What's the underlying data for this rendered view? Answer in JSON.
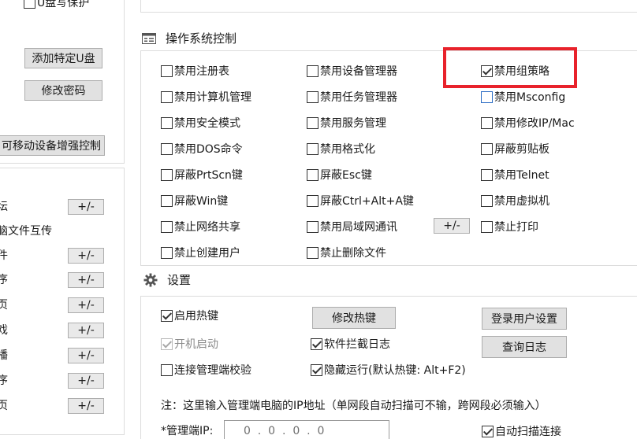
{
  "left_panel": {
    "usb_protect_label": "U盘写保护",
    "add_usb_button": "添加特定U盘",
    "change_password_button": "修改密码",
    "removable_enhanced_button": "可移动设备增强控制",
    "rows": [
      {
        "label": "坛",
        "has_button": true
      },
      {
        "label": "脑文件互传",
        "has_button": false
      },
      {
        "label": "件",
        "has_button": true
      },
      {
        "label": "序",
        "has_button": true
      },
      {
        "label": "页",
        "has_button": true
      },
      {
        "label": "戏",
        "has_button": true
      },
      {
        "label": "播",
        "has_button": true
      },
      {
        "label": "序",
        "has_button": true
      },
      {
        "label": "页",
        "has_button": true
      }
    ],
    "pm_label": "+/-"
  },
  "os_control": {
    "title": "操作系统控制",
    "col1": [
      {
        "label": "禁用注册表",
        "checked": false
      },
      {
        "label": "禁用计算机管理",
        "checked": false
      },
      {
        "label": "禁用安全模式",
        "checked": false
      },
      {
        "label": "禁用DOS命令",
        "checked": false
      },
      {
        "label": "屏蔽PrtScn键",
        "checked": false
      },
      {
        "label": "屏蔽Win键",
        "checked": false
      },
      {
        "label": "禁止网络共享",
        "checked": false
      },
      {
        "label": "禁止创建用户",
        "checked": false
      }
    ],
    "col2": [
      {
        "label": "禁用设备管理器",
        "checked": false
      },
      {
        "label": "禁用任务管理器",
        "checked": false
      },
      {
        "label": "禁用服务管理",
        "checked": false
      },
      {
        "label": "禁用格式化",
        "checked": false
      },
      {
        "label": "屏蔽Esc键",
        "checked": false
      },
      {
        "label": "屏蔽Ctrl+Alt+A键",
        "checked": false
      },
      {
        "label": "禁用局域网通讯",
        "checked": false
      },
      {
        "label": "禁止删除文件",
        "checked": false
      }
    ],
    "col3": [
      {
        "label": "禁用组策略",
        "checked": true
      },
      {
        "label": "禁用Msconfig",
        "checked": false
      },
      {
        "label": "禁用修改IP/Mac",
        "checked": false
      },
      {
        "label": "屏蔽剪贴板",
        "checked": false
      },
      {
        "label": "禁用Telnet",
        "checked": false
      },
      {
        "label": "禁用虚拟机",
        "checked": false
      },
      {
        "label": "禁止打印",
        "checked": false
      }
    ],
    "lan_pm_label": "+/-",
    "highlight_color": "#e8222b"
  },
  "settings": {
    "title": "设置",
    "enable_hotkey": {
      "label": "启用热键",
      "checked": true
    },
    "auto_start": {
      "label": "开机启动",
      "checked": true
    },
    "connect_verify": {
      "label": "连接管理端校验",
      "checked": false
    },
    "modify_hotkey_button": "修改热键",
    "block_log": {
      "label": "软件拦截日志",
      "checked": true
    },
    "hidden_run": {
      "label": "隐藏运行(默认热键: Alt+F2)",
      "checked": true
    },
    "login_user_button": "登录用户设置",
    "query_log_button": "查询日志",
    "note": "注：这里输入管理端电脑的IP地址（单网段自动扫描可不输，跨网段必须输入）",
    "ip_label": "*管理端IP:",
    "ip_value": "0  .  0  .  0  .  0",
    "auto_scan": {
      "label": "自动扫描连接",
      "checked": true
    }
  }
}
